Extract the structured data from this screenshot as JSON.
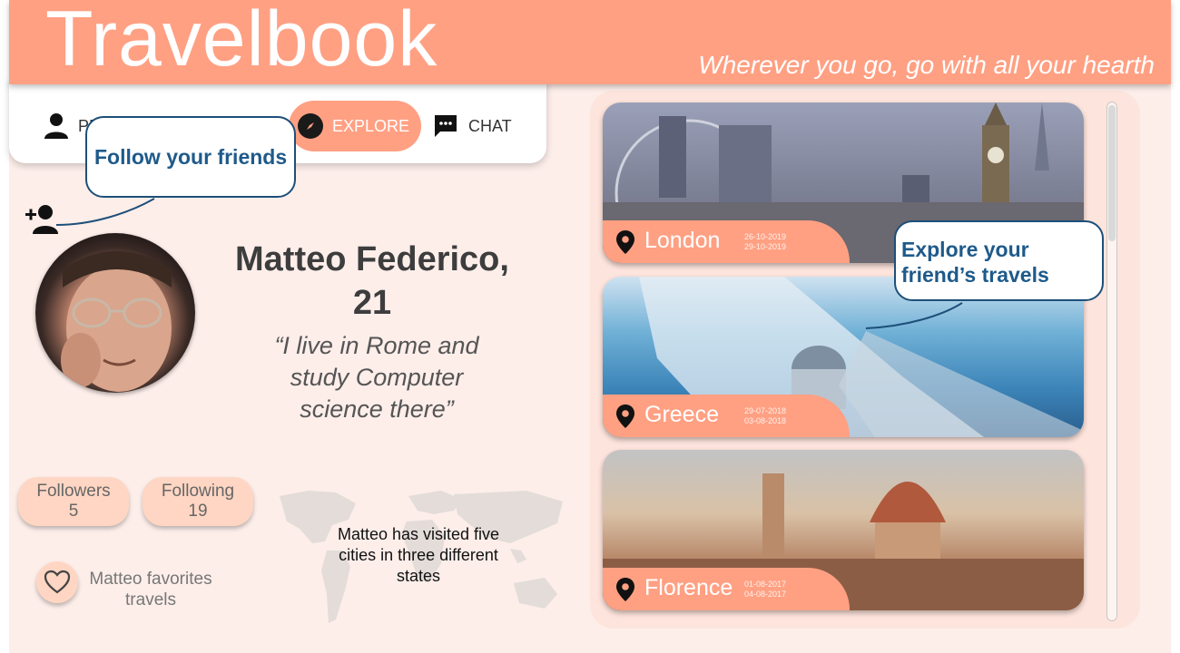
{
  "app": {
    "title": "Travelbook",
    "tagline": "Wherever you go, go with all your hearth"
  },
  "nav": {
    "items": [
      {
        "label": "PROFILE",
        "icon": "person-icon"
      },
      {
        "label": "EXPLORE",
        "icon": "compass-icon",
        "active": true
      },
      {
        "label": "CHAT",
        "icon": "chat-bubble-icon"
      }
    ],
    "profile_visible": "PR"
  },
  "tooltips": {
    "follow": "Follow your friends",
    "explore_line1": "Explore your",
    "explore_line2": "friend’s travels"
  },
  "profile": {
    "name_line1": "Matteo Federico,",
    "name_line2": "21",
    "bio_line1": "“I live in Rome and",
    "bio_line2": "study Computer",
    "bio_line3": "science there”",
    "followers_label": "Followers",
    "followers_count": "5",
    "following_label": "Following",
    "following_count": "19",
    "favorites_line1": "Matteo favorites",
    "favorites_line2": "travels"
  },
  "map": {
    "caption_line1": "Matteo has visited five",
    "caption_line2": "cities in three different",
    "caption_line3": "states"
  },
  "travels": [
    {
      "city": "London",
      "date_from": "26-10-2019",
      "date_to": "29-10-2019"
    },
    {
      "city": "Greece",
      "date_from": "29-07-2018",
      "date_to": "03-08-2018"
    },
    {
      "city": "Florence",
      "date_from": "01-08-2017",
      "date_to": "04-08-2017"
    }
  ],
  "colors": {
    "accent": "#ffa083",
    "background": "#fdeeea",
    "tooltip_text": "#1e5a8a",
    "chip": "#ffd6c3"
  }
}
